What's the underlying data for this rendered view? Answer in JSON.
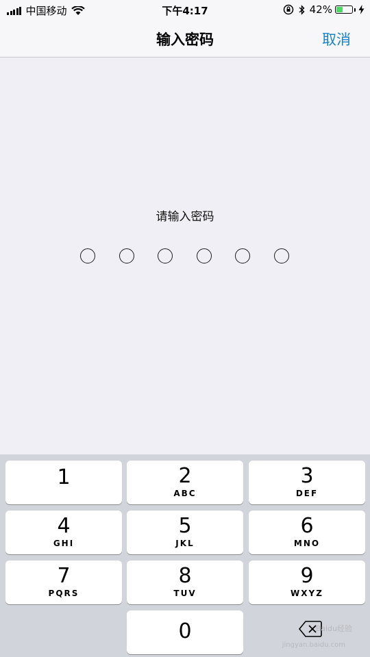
{
  "status_bar": {
    "carrier": "中国移动",
    "time": "下午4:17",
    "battery_percent": "42%",
    "battery_level": 0.42,
    "icons": [
      "signal-icon",
      "wifi-icon",
      "rotation-lock-icon",
      "bluetooth-icon",
      "battery-icon",
      "charging-bolt-icon"
    ]
  },
  "nav": {
    "title": "输入密码",
    "cancel_label": "取消"
  },
  "prompt": "请输入密码",
  "passcode": {
    "length": 6,
    "entered": 0
  },
  "keypad": {
    "keys": [
      {
        "num": "1",
        "letters": ""
      },
      {
        "num": "2",
        "letters": "ABC"
      },
      {
        "num": "3",
        "letters": "DEF"
      },
      {
        "num": "4",
        "letters": "GHI"
      },
      {
        "num": "5",
        "letters": "JKL"
      },
      {
        "num": "6",
        "letters": "MNO"
      },
      {
        "num": "7",
        "letters": "PQRS"
      },
      {
        "num": "8",
        "letters": "TUV"
      },
      {
        "num": "9",
        "letters": "WXYZ"
      },
      {
        "num": "0",
        "letters": ""
      }
    ],
    "backspace_icon": "backspace-icon"
  },
  "watermark": {
    "brand": "Baidu经验",
    "url": "jingyan.baidu.com"
  },
  "colors": {
    "accent": "#1a82c9",
    "battery": "#4cd964",
    "keypad_bg": "#d1d4db"
  }
}
